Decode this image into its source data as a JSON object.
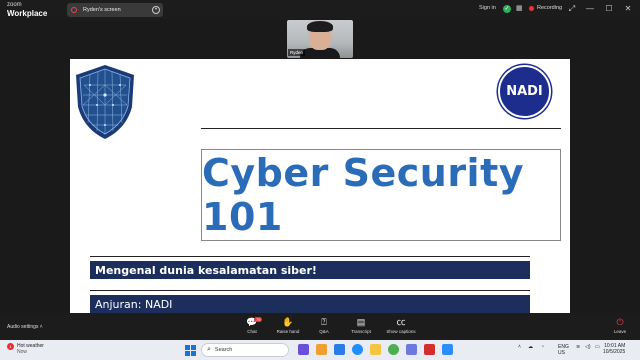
{
  "window": {
    "brand_top": "zoom",
    "brand_bottom": "Workplace",
    "tab_label": "Ryden's screen",
    "sign_in": "Sign in",
    "recording": "Recording",
    "minimize": "—",
    "maximize": "☐",
    "close": "✕"
  },
  "video": {
    "participant_name": "Ryden"
  },
  "slide": {
    "logo_text": "NADI",
    "title": "Cyber Security 101",
    "subtitle": "Mengenal dunia kesalamatan siber!",
    "organizer": "Anjuran: NADI",
    "colors": {
      "title": "#2b6cb8",
      "bar": "#1b2e5c",
      "logo": "#1d2d8e"
    }
  },
  "controls": {
    "audio_settings": "Audio settings",
    "items": [
      {
        "label": "Chat",
        "icon": "chat-icon",
        "badge": "79"
      },
      {
        "label": "Raise hand",
        "icon": "hand-icon"
      },
      {
        "label": "Q&A",
        "icon": "qa-icon"
      },
      {
        "label": "Transcript",
        "icon": "transcript-icon"
      },
      {
        "label": "Show captions",
        "icon": "cc-icon"
      }
    ],
    "leave": "Leave"
  },
  "taskbar": {
    "weather_title": "Hot weather",
    "weather_sub": "Now",
    "search_placeholder": "Search",
    "language": "ENG",
    "region": "US",
    "time": "10:01 AM",
    "date": "10/5/2025"
  }
}
